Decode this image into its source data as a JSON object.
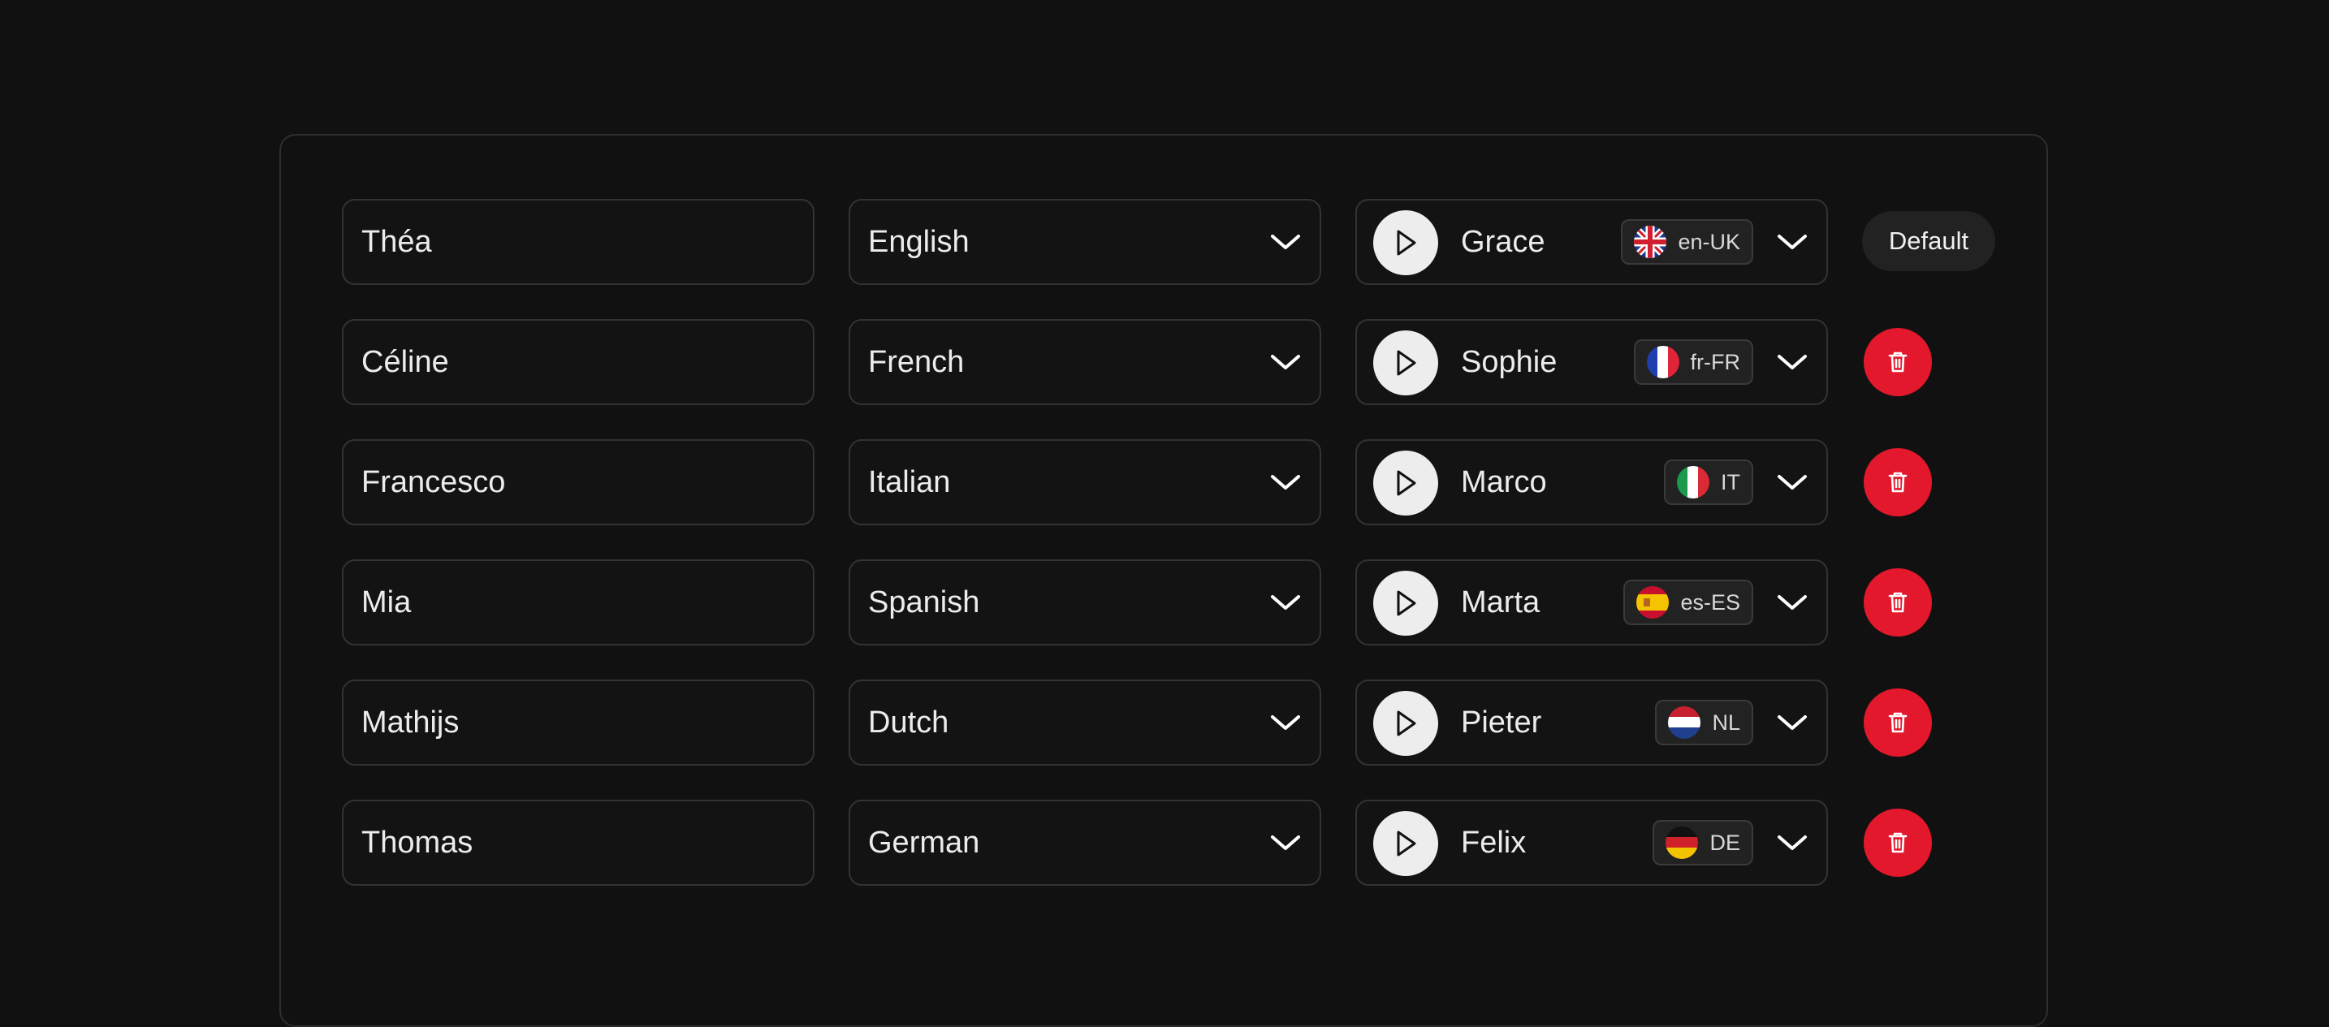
{
  "rows": [
    {
      "name": "Théa",
      "language": "English",
      "voice": "Grace",
      "locale": "en-UK",
      "flag_icon": "uk-flag-icon",
      "action": "Default"
    },
    {
      "name": "Céline",
      "language": "French",
      "voice": "Sophie",
      "locale": "fr-FR",
      "flag_icon": "france-flag-icon",
      "action": "delete"
    },
    {
      "name": "Francesco",
      "language": "Italian",
      "voice": "Marco",
      "locale": "IT",
      "flag_icon": "italy-flag-icon",
      "action": "delete"
    },
    {
      "name": "Mia",
      "language": "Spanish",
      "voice": "Marta",
      "locale": "es-ES",
      "flag_icon": "spain-flag-icon",
      "action": "delete"
    },
    {
      "name": "Mathijs",
      "language": "Dutch",
      "voice": "Pieter",
      "locale": "NL",
      "flag_icon": "netherlands-flag-icon",
      "action": "delete"
    },
    {
      "name": "Thomas",
      "language": "German",
      "voice": "Felix",
      "locale": "DE",
      "flag_icon": "germany-flag-icon",
      "action": "delete"
    }
  ],
  "icons": {
    "play": "play-icon",
    "chevron": "chevron-down-icon",
    "delete": "trash-icon"
  },
  "colors": {
    "background": "#111111",
    "delete_button": "#e3182d",
    "play_button": "#ededed",
    "default_button": "#222222"
  }
}
